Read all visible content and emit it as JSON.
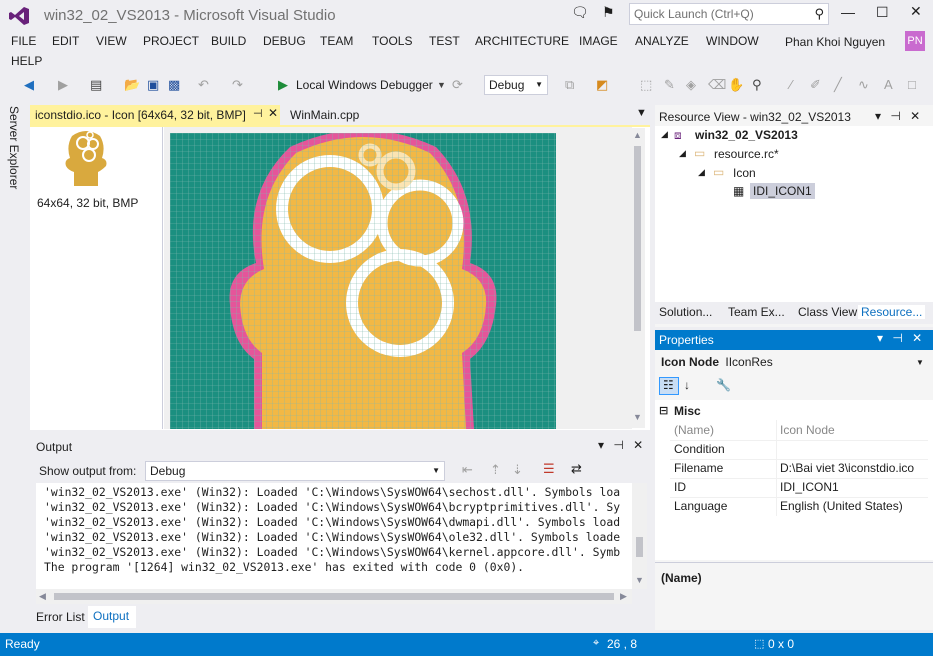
{
  "window": {
    "title": "win32_02_VS2013 - Microsoft Visual Studio",
    "quick_launch": "Quick Launch (Ctrl+Q)",
    "user": "Phan Khoi Nguyen",
    "user_initials": "PN"
  },
  "menu": [
    "FILE",
    "EDIT",
    "VIEW",
    "PROJECT",
    "BUILD",
    "DEBUG",
    "TEAM",
    "TOOLS",
    "TEST",
    "ARCHITECTURE",
    "IMAGE",
    "ANALYZE",
    "WINDOW",
    "HELP"
  ],
  "toolbar": {
    "debugger": "Local Windows Debugger",
    "config": "Debug"
  },
  "sidebar": {
    "server_explorer": "Server Explorer"
  },
  "tabs": [
    {
      "label": "iconstdio.ico - Icon [64x64, 32 bit, BMP]"
    },
    {
      "label": "WinMain.cpp"
    }
  ],
  "editor": {
    "thumb_label": "64x64, 32 bit, BMP"
  },
  "output": {
    "title": "Output",
    "show_from": "Show output from:",
    "source": "Debug",
    "lines": [
      "'win32_02_VS2013.exe' (Win32): Loaded 'C:\\Windows\\SysWOW64\\sechost.dll'. Symbols loa",
      "'win32_02_VS2013.exe' (Win32): Loaded 'C:\\Windows\\SysWOW64\\bcryptprimitives.dll'. Sy",
      "'win32_02_VS2013.exe' (Win32): Loaded 'C:\\Windows\\SysWOW64\\dwmapi.dll'. Symbols load",
      "'win32_02_VS2013.exe' (Win32): Loaded 'C:\\Windows\\SysWOW64\\ole32.dll'. Symbols loade",
      "'win32_02_VS2013.exe' (Win32): Loaded 'C:\\Windows\\SysWOW64\\kernel.appcore.dll'. Symb",
      "The program '[1264] win32_02_VS2013.exe' has exited with code 0 (0x0)."
    ]
  },
  "bottom_tabs": [
    "Error List",
    "Output"
  ],
  "resource_view": {
    "title": "Resource View - win32_02_VS2013",
    "project": "win32_02_VS2013",
    "rc": "resource.rc*",
    "folder": "Icon",
    "item": "IDI_ICON1",
    "tabs": [
      "Solution...",
      "Team Ex...",
      "Class View",
      "Resource..."
    ]
  },
  "properties": {
    "title": "Properties",
    "selector_bold": "Icon Node",
    "selector_rest": "IIconRes",
    "category": "Misc",
    "rows": [
      {
        "name": "(Name)",
        "value": "Icon Node"
      },
      {
        "name": "Condition",
        "value": ""
      },
      {
        "name": "Filename",
        "value": "D:\\Bai viet 3\\iconstdio.ico"
      },
      {
        "name": "ID",
        "value": "IDI_ICON1"
      },
      {
        "name": "Language",
        "value": "English (United States)"
      }
    ],
    "description": "(Name)"
  },
  "status": {
    "ready": "Ready",
    "position": "26 , 8",
    "size": "0 x 0"
  },
  "colors": {
    "accent": "#007ACC",
    "tab_active": "#FFF29D",
    "icon_body": "#F2B845",
    "icon_bg": "#1B8F80",
    "icon_edge": "#E5559A"
  }
}
